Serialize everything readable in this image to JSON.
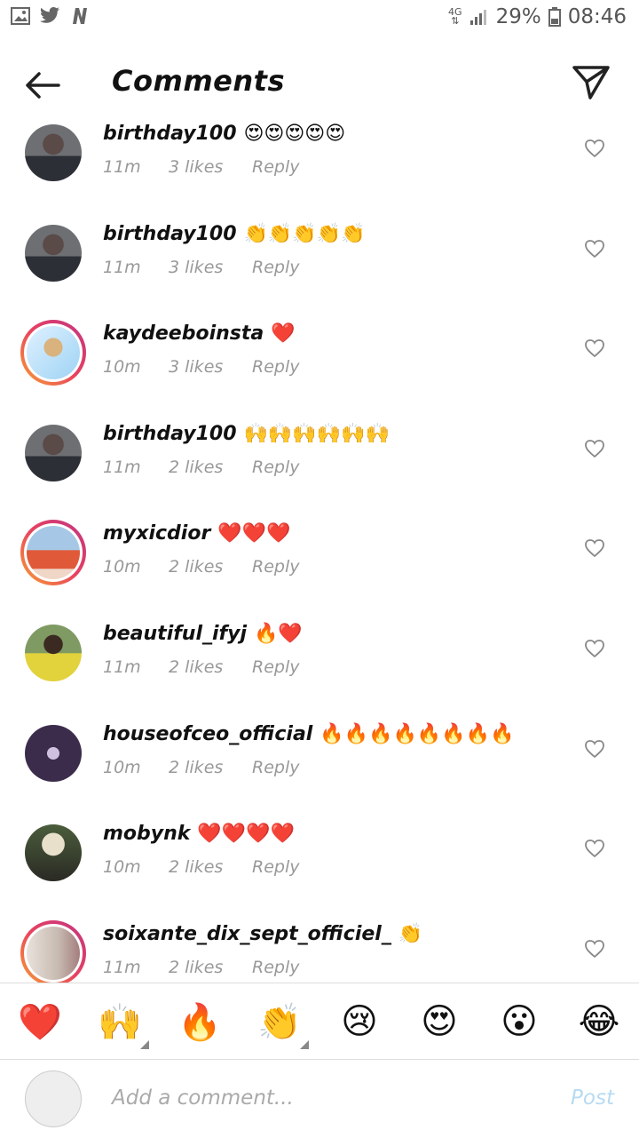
{
  "statusbar": {
    "left_icons": [
      "image-icon",
      "twitter-icon",
      "n-icon"
    ],
    "network": "4G",
    "battery": "29%",
    "time": "08:46"
  },
  "header": {
    "title": "Comments"
  },
  "comments": [
    {
      "username": "birthday100",
      "emoji": "😍😍😍😍😍",
      "time": "11m",
      "likes": "3 likes",
      "reply": "Reply",
      "avatar": "a1"
    },
    {
      "username": "birthday100",
      "emoji": "👏👏👏👏👏",
      "time": "11m",
      "likes": "3 likes",
      "reply": "Reply",
      "avatar": "a1"
    },
    {
      "username": "kaydeeboinsta",
      "emoji": "❤️",
      "time": "10m",
      "likes": "3 likes",
      "reply": "Reply",
      "avatar": "a2"
    },
    {
      "username": "birthday100",
      "emoji": "🙌🙌🙌🙌🙌🙌",
      "time": "11m",
      "likes": "2 likes",
      "reply": "Reply",
      "avatar": "a1"
    },
    {
      "username": "myxicdior",
      "emoji": "❤️❤️❤️",
      "time": "10m",
      "likes": "2 likes",
      "reply": "Reply",
      "avatar": "a3"
    },
    {
      "username": "beautiful_ifyj",
      "emoji": "🔥❤️",
      "time": "11m",
      "likes": "2 likes",
      "reply": "Reply",
      "avatar": "a4"
    },
    {
      "username": "houseofceo_official",
      "emoji": "🔥🔥🔥🔥🔥🔥🔥🔥",
      "time": "10m",
      "likes": "2 likes",
      "reply": "Reply",
      "avatar": "a5"
    },
    {
      "username": "mobynk",
      "emoji": "❤️❤️❤️❤️",
      "time": "10m",
      "likes": "2 likes",
      "reply": "Reply",
      "avatar": "a6"
    },
    {
      "username": "soixante_dix_sept_officiel_",
      "emoji": "👏",
      "time": "11m",
      "likes": "2 likes",
      "reply": "Reply",
      "avatar": "a7"
    }
  ],
  "reactions": [
    "❤️",
    "🙌",
    "🔥",
    "👏",
    "😢",
    "😍",
    "😮",
    "😂"
  ],
  "composer": {
    "placeholder": "Add a comment...",
    "post_label": "Post"
  }
}
